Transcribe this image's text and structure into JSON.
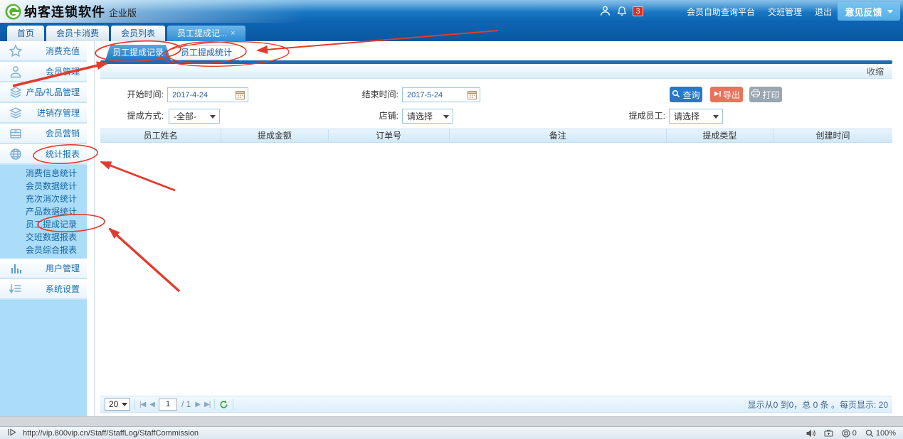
{
  "header": {
    "logo": "纳客连锁软件",
    "edition": "企业版",
    "badge": "3",
    "links": [
      "会员自助查询平台",
      "交班管理",
      "退出"
    ],
    "feedback": "意见反馈"
  },
  "nav_close": "×",
  "nav_tabs": [
    {
      "key": "home",
      "label": "首页",
      "active": false
    },
    {
      "key": "member-card-consume",
      "label": "会员卡消费",
      "active": false
    },
    {
      "key": "member-list",
      "label": "会员列表",
      "active": false
    },
    {
      "key": "staff-commission",
      "label": "员工提成记...",
      "active": true
    }
  ],
  "sidebar": {
    "items_top": [
      {
        "key": "consume-recharge",
        "icon": "star",
        "label": "消费充值"
      },
      {
        "key": "member-management",
        "icon": "member",
        "label": "会员管理"
      },
      {
        "key": "product-gift-management",
        "icon": "products",
        "label": "产品/礼品管理"
      },
      {
        "key": "inventory-management",
        "icon": "inventory",
        "label": "进销存管理"
      },
      {
        "key": "member-marketing",
        "icon": "marketing",
        "label": "会员营销"
      },
      {
        "key": "statistics-reports",
        "icon": "reports",
        "label": "统计报表"
      }
    ],
    "submenu": [
      {
        "key": "consumption-info-stats",
        "label": "消费信息统计"
      },
      {
        "key": "member-data-stats",
        "label": "会员数据统计"
      },
      {
        "key": "recharge-consume-count-stats",
        "label": "充次消次统计"
      },
      {
        "key": "product-data-stats",
        "label": "产品数据统计"
      },
      {
        "key": "staff-commission-records",
        "label": "员工提成记录"
      },
      {
        "key": "shift-data-report",
        "label": "交班数据报表"
      },
      {
        "key": "member-comprehensive-report",
        "label": "会员综合报表"
      }
    ],
    "items_bottom": [
      {
        "key": "user-management",
        "icon": "users",
        "label": "用户管理"
      },
      {
        "key": "system-settings",
        "icon": "settings",
        "label": "系统设置"
      }
    ]
  },
  "content": {
    "tabs": [
      "员工提成记录",
      "员工提成统计"
    ],
    "collapse": "收缩"
  },
  "filters": {
    "start_label": "开始时间:",
    "start_value": "2017-4-24",
    "end_label": "结束时间:",
    "end_value": "2017-5-24",
    "method_label": "提成方式:",
    "method_value": "-全部-",
    "store_label": "店铺:",
    "store_value": "请选择",
    "staff_label": "提成员工:",
    "staff_value": "请选择"
  },
  "buttons": {
    "search": "查询",
    "export": "导出",
    "print": "打印"
  },
  "table": {
    "headers": [
      "员工姓名",
      "提成金额",
      "订单号",
      "备注",
      "提成类型",
      "创建时间"
    ]
  },
  "pager": {
    "page_size": "20",
    "page": "1",
    "of": "/ 1",
    "summary": "显示从0 到0，总 0 条 。每页显示: 20"
  },
  "status": {
    "url": "http://vip.800vip.cn/Staff/StaffLog/StaffCommission",
    "console_count": "0",
    "zoom": "100%"
  },
  "colors": {
    "header_blue": "#1b7ac6",
    "accent_blue": "#2579c8",
    "export_orange": "#e8735c",
    "print_gray": "#9aa6b0",
    "sidebar_blue": "#abdcf8",
    "annotation_red": "#e23b2d"
  }
}
